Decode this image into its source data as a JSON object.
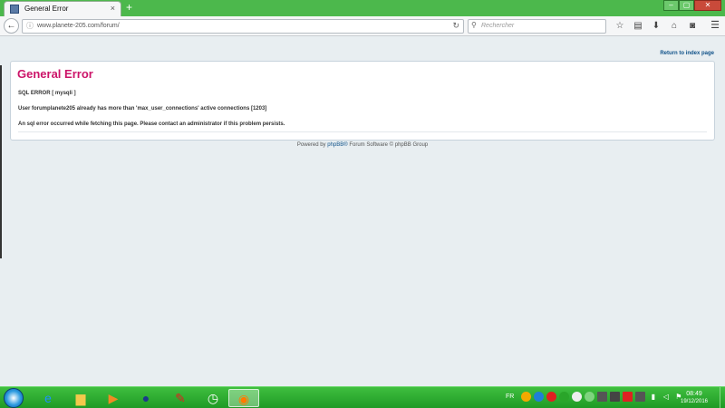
{
  "browser": {
    "tab_title": "General Error",
    "tab_close": "×",
    "new_tab": "+",
    "url": "www.planete-205.com/forum/",
    "search_placeholder": "Rechercher",
    "window_buttons": [
      "–",
      "▢",
      "✕"
    ]
  },
  "page": {
    "return_link": "Return to index page",
    "title": "General Error",
    "lines": [
      "SQL ERROR [ mysqli ]",
      "User forumplanete205 already has more than 'max_user_connections' active connections [1203]",
      "An sql error occurred while fetching this page. Please contact an administrator if this problem persists."
    ],
    "footer": {
      "prefix": "Powered by ",
      "link": "phpBB®",
      "suffix": " Forum Software © phpBB Group"
    }
  },
  "taskbar": {
    "apps": [
      "ie-icon",
      "explorer-icon",
      "media-icon",
      "user-icon",
      "pin-icon",
      "clock-app-icon",
      "firefox-icon"
    ],
    "language": "FR",
    "time": "08:49",
    "date": "19/12/2016"
  },
  "colors": {
    "title_bar": "#4cb84c",
    "error_title": "#cc1469",
    "link": "#105289",
    "page_bg": "#e8eef1"
  }
}
